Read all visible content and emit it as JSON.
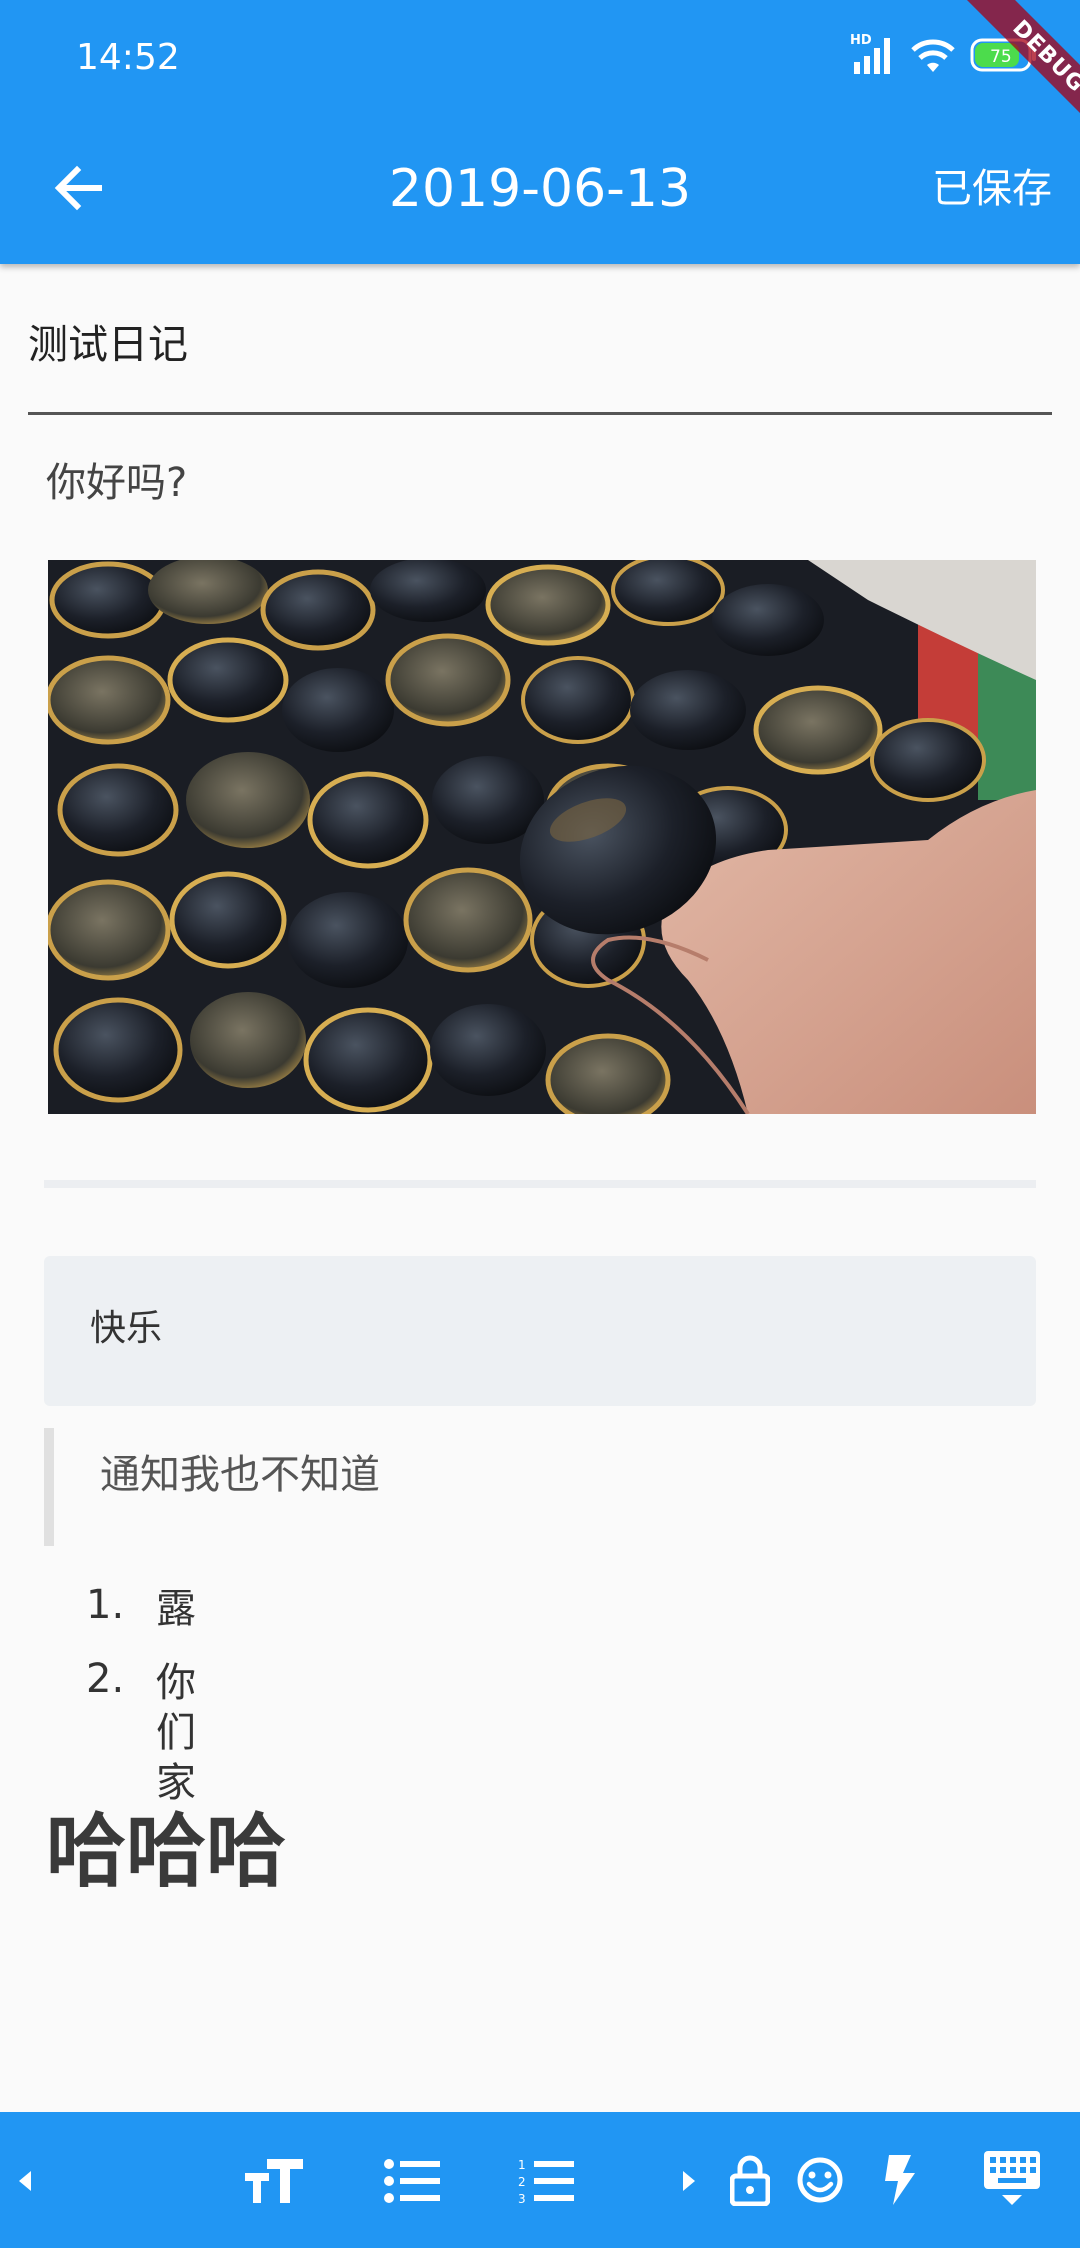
{
  "status_bar": {
    "time": "14:52",
    "hd_label": "HD",
    "battery_level": "75"
  },
  "debug_banner": "DEBUG",
  "header": {
    "title": "2019-06-13",
    "saved_label": "已保存",
    "back_icon": "arrow-left-icon",
    "background": "#2196f3"
  },
  "entry": {
    "title": "测试日记",
    "paragraph": "你好吗?",
    "image_alt_icon": "photo-clams",
    "code_text": "快乐",
    "quote_text": "通知我也不知道",
    "list_items": [
      {
        "num": "1.",
        "text": "露"
      },
      {
        "num": "2.",
        "text": "你们家"
      }
    ],
    "heading": "哈哈哈"
  },
  "toolbar": {
    "background": "#2196f3",
    "icons": [
      "caret-left-icon",
      "text-size-icon",
      "bulleted-list-icon",
      "numbered-list-icon",
      "caret-right-icon",
      "lock-icon",
      "emoji-icon",
      "lightning-icon",
      "keyboard-hide-icon"
    ]
  }
}
